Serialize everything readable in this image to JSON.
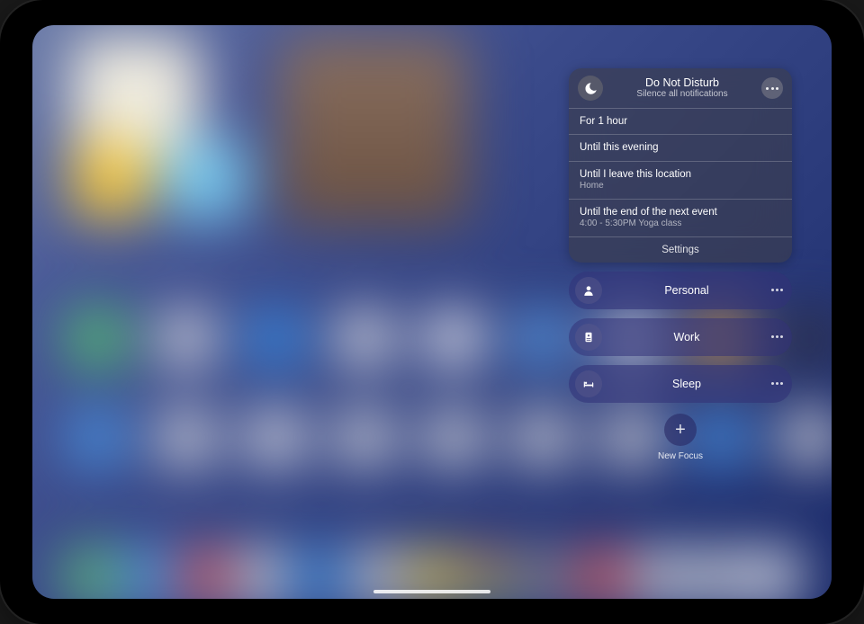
{
  "dnd": {
    "title": "Do Not Disturb",
    "subtitle": "Silence all notifications",
    "options": [
      {
        "label": "For 1 hour"
      },
      {
        "label": "Until this evening"
      },
      {
        "label": "Until I leave this location",
        "sub": "Home"
      },
      {
        "label": "Until the end of the next event",
        "sub": "4:00 - 5:30PM Yoga class"
      }
    ],
    "settings_label": "Settings"
  },
  "focus_modes": [
    {
      "name": "Personal",
      "icon": "person"
    },
    {
      "name": "Work",
      "icon": "badge"
    },
    {
      "name": "Sleep",
      "icon": "bed"
    }
  ],
  "new_focus_label": "New Focus"
}
